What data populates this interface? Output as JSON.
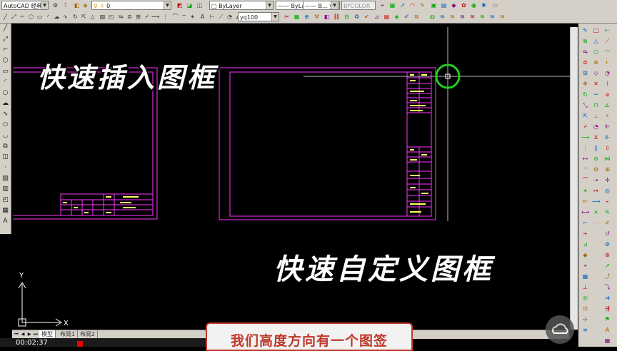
{
  "toolbar": {
    "workspace": "AutoCAD 经典",
    "layer_value": "0",
    "color_value": "ByLayer",
    "linetype_value": "ByLayer",
    "lineweight_value": "B... ye",
    "plotstyle_value": "BYCOLOR",
    "textstyle_value": "yq100"
  },
  "overlay": {
    "title_insert": "快速插入图框",
    "title_custom": "快速自定义图框",
    "subtitle": "我们高度方向有一个图签",
    "time": "00:02:37"
  },
  "axis": {
    "y": "Y",
    "x": "X"
  },
  "tabs": {
    "model": "模型",
    "layout1": "布局1",
    "layout2": "布局2"
  },
  "colors": {
    "frame": "#ff33ff",
    "background": "#000000",
    "crosshair_circle": "#22cc22",
    "subtitle_accent": "#c0392b"
  }
}
